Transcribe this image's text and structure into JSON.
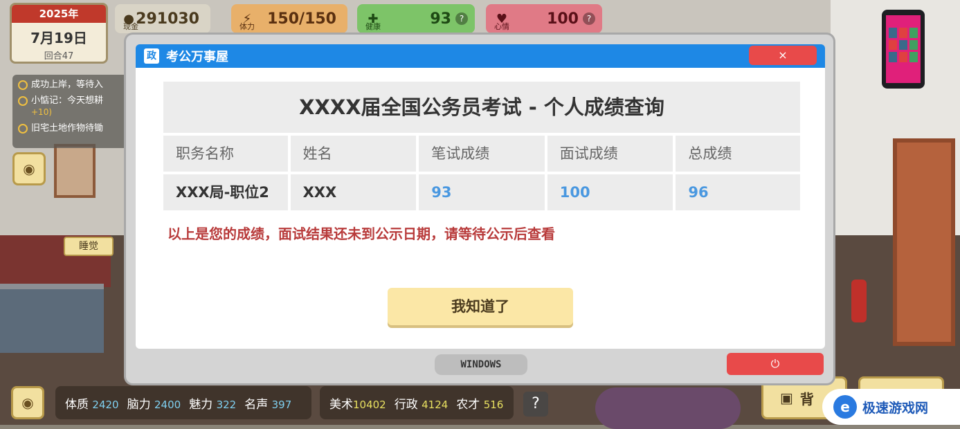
{
  "hud": {
    "year": "2025年",
    "date": "7月19日",
    "round": "回合47",
    "cash": {
      "label": "现金",
      "value": "291030"
    },
    "energy": {
      "label": "体力",
      "value": "150/150"
    },
    "health": {
      "label": "健康",
      "value": "93",
      "help": "?"
    },
    "mood": {
      "label": "心情",
      "value": "100",
      "help": "?"
    }
  },
  "tasks": [
    {
      "text": "成功上岸，等待入"
    },
    {
      "text": "小惦记：今天想耕",
      "reward": "+10)"
    },
    {
      "text": "旧宅土地作物待锄"
    }
  ],
  "scene": {
    "sleep_label": "睡觉"
  },
  "window": {
    "app_icon": "政",
    "title": "考公万事屋",
    "close": "×",
    "table_title": "XXXX届全国公务员考试 - 个人成绩查询",
    "headers": [
      "职务名称",
      "姓名",
      "笔试成绩",
      "面试成绩",
      "总成绩"
    ],
    "row": [
      "XXX局-职位2",
      "XXX",
      "93",
      "100",
      "96"
    ],
    "notice": "以上是您的成绩，面试结果还未到公示日期，请等待公示后查看",
    "ok_button": "我知道了",
    "taskbar_label": "WINDOWS",
    "power_icon": "⏻"
  },
  "attributes": [
    {
      "name": "体质",
      "value": "2420"
    },
    {
      "name": "脑力",
      "value": "2400"
    },
    {
      "name": "魅力",
      "value": "322"
    },
    {
      "name": "名声",
      "value": "397"
    }
  ],
  "attributes2": [
    {
      "name": "美术",
      "value": "10402"
    },
    {
      "name": "行政",
      "value": "4124"
    },
    {
      "name": "农才",
      "value": "516"
    }
  ],
  "bottom": {
    "help": "?",
    "bag_label": "背"
  },
  "watermark": {
    "logo": "e",
    "text": "极速游戏网"
  }
}
